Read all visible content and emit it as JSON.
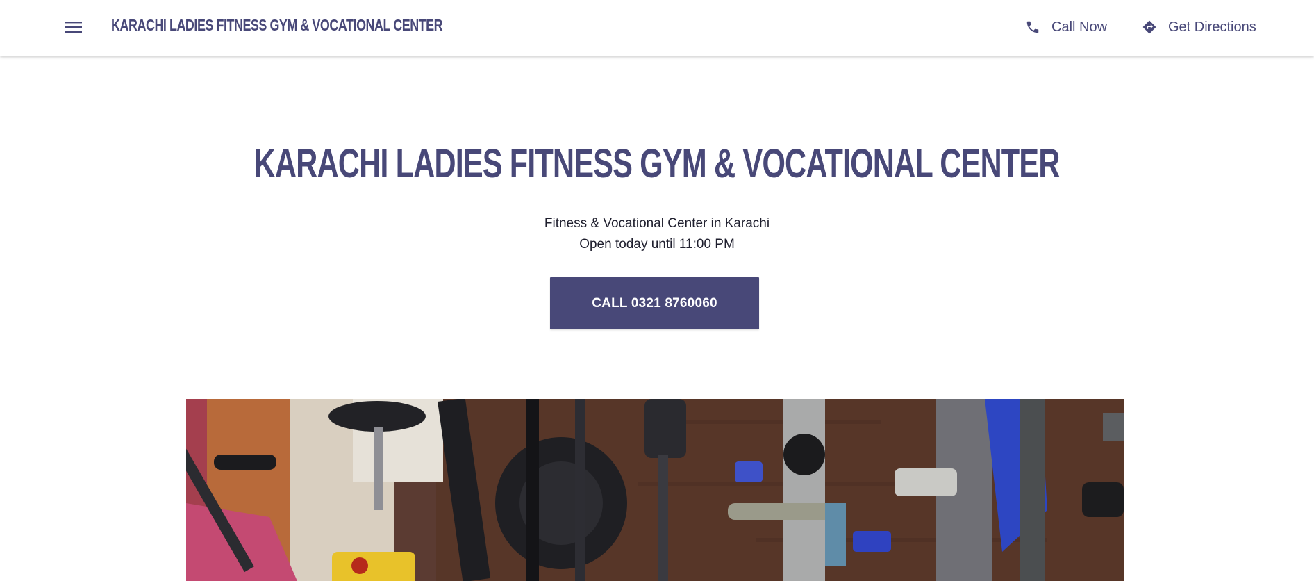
{
  "header": {
    "menu_icon": "hamburger-menu-icon",
    "brand": "KARACHI LADIES FITNESS GYM & VOCATIONAL CENTER",
    "call_label": "Call Now",
    "call_icon": "phone-icon",
    "directions_label": "Get Directions",
    "directions_icon": "directions-diamond-icon"
  },
  "hero": {
    "title": "KARACHI LADIES FITNESS GYM & VOCATIONAL CENTER",
    "subtitle": "Fitness & Vocational Center in Karachi",
    "hours": "Open today until 11:00 PM",
    "cta_label": "CALL 0321 8760060"
  },
  "colors": {
    "accent": "#484878",
    "text": "#1f1f2e",
    "background": "#ffffff"
  }
}
